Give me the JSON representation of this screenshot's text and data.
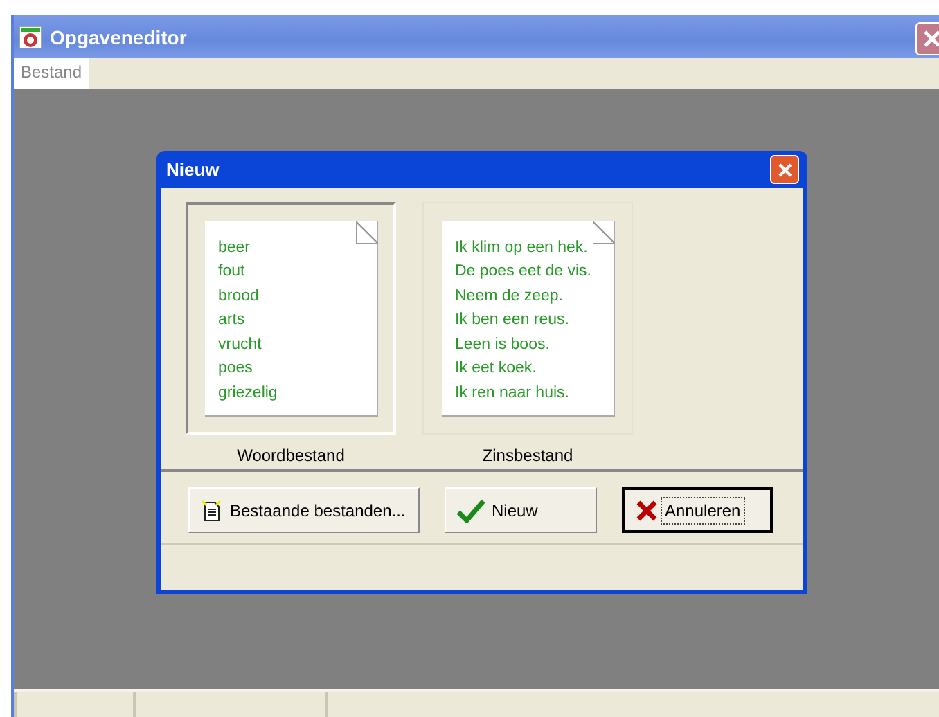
{
  "window": {
    "title": "Opgaveneditor"
  },
  "menu": [
    {
      "label": "Bestand"
    }
  ],
  "dialog": {
    "title": "Nieuw",
    "options": [
      {
        "caption": "Woordbestand",
        "selected": true,
        "lines": [
          "beer",
          "fout",
          "brood",
          "arts",
          "vrucht",
          "poes",
          "griezelig"
        ]
      },
      {
        "caption": "Zinsbestand",
        "selected": false,
        "lines": [
          "Ik klim op een hek.",
          "De poes eet de vis.",
          "Neem de zeep.",
          "Ik ben een reus.",
          "Leen is boos.",
          "Ik eet koek.",
          "Ik ren naar huis."
        ]
      }
    ],
    "buttons": [
      {
        "kind": "open",
        "label": "Bestaande bestanden...",
        "default": false
      },
      {
        "kind": "new",
        "label": "Nieuw",
        "default": false
      },
      {
        "kind": "cancel",
        "label": "Annuleren",
        "default": true
      }
    ]
  }
}
